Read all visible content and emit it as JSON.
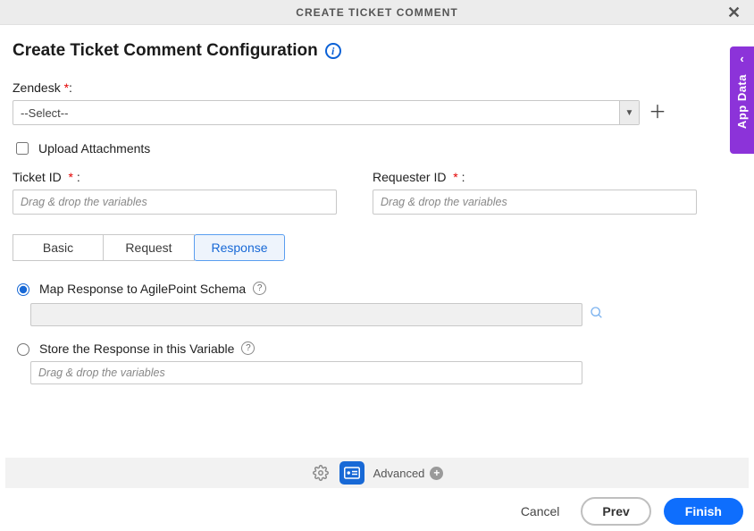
{
  "header": {
    "title": "CREATE TICKET COMMENT"
  },
  "side_tab": {
    "label": "App Data"
  },
  "page": {
    "title": "Create Ticket Comment Configuration"
  },
  "zendesk": {
    "label": "Zendesk",
    "star": "*",
    "colon": ":",
    "selected": "--Select--"
  },
  "upload": {
    "label": "Upload Attachments"
  },
  "ticket_id": {
    "label": "Ticket ID",
    "star": "*",
    "colon": ":",
    "placeholder": "Drag & drop the variables"
  },
  "requester_id": {
    "label": "Requester ID",
    "star": "*",
    "colon": ":",
    "placeholder": "Drag & drop the variables"
  },
  "tabs": {
    "basic": "Basic",
    "request": "Request",
    "response": "Response"
  },
  "radios": {
    "map": {
      "label": "Map Response to AgilePoint Schema"
    },
    "store": {
      "label": "Store the Response in this Variable",
      "placeholder": "Drag & drop the variables"
    }
  },
  "footer": {
    "advanced": "Advanced",
    "cancel": "Cancel",
    "prev": "Prev",
    "finish": "Finish"
  }
}
